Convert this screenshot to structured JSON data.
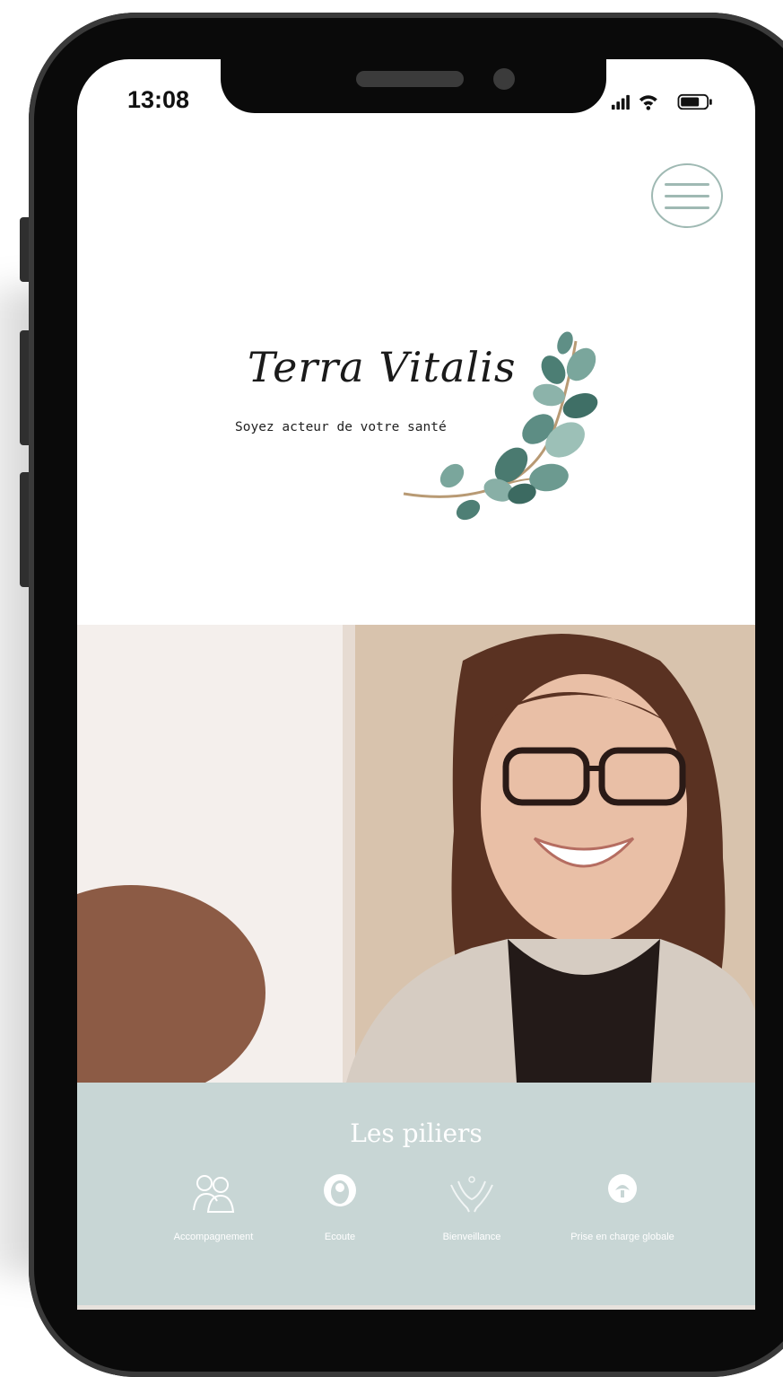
{
  "status_bar": {
    "time": "13:08"
  },
  "menu": {
    "icon": "hamburger-menu-icon"
  },
  "logo": {
    "name": "Terra Vitalis",
    "tagline": "Soyez acteur de votre santé"
  },
  "hero": {
    "alt": "smiling woman with glasses"
  },
  "pillars": {
    "title": "Les piliers",
    "items": [
      {
        "label": "Accompagnement",
        "icon": "people-icon"
      },
      {
        "label": "Ecoute",
        "icon": "listening-face-icon"
      },
      {
        "label": "Bienveillance",
        "icon": "hands-icon"
      },
      {
        "label": "Prise en charge globale",
        "icon": "holistic-care-icon"
      }
    ]
  },
  "colors": {
    "accent": "#9fb9b3",
    "pillars_bg": "#c8d6d5",
    "frame": "#0a0a0a"
  }
}
